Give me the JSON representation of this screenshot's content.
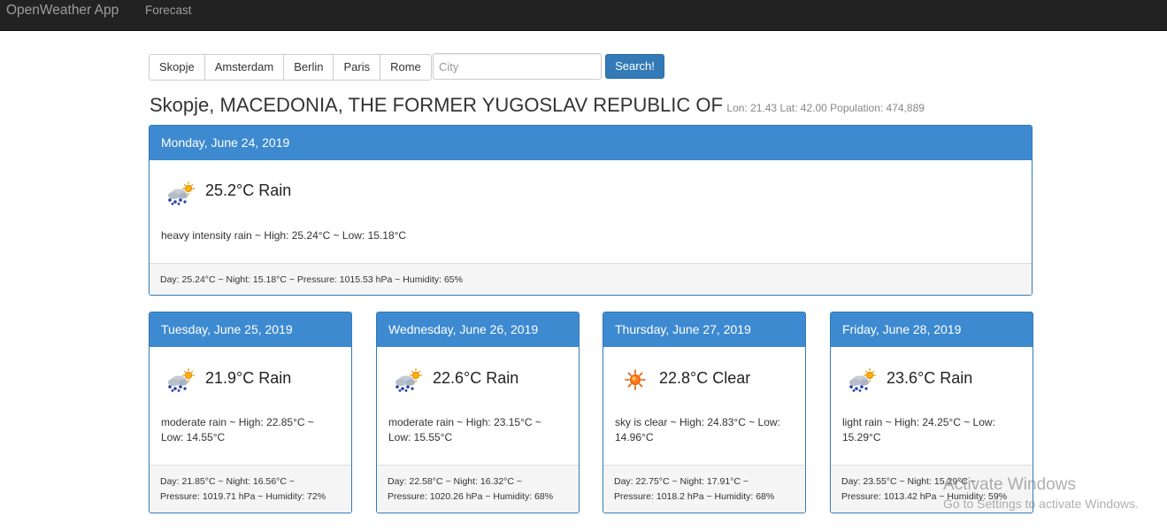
{
  "navbar": {
    "brand": "OpenWeather App",
    "forecast_link": "Forecast"
  },
  "cities": [
    "Skopje",
    "Amsterdam",
    "Berlin",
    "Paris",
    "Rome"
  ],
  "search": {
    "placeholder": "City",
    "button_label": "Search!"
  },
  "location": {
    "title": "Skopje, MACEDONIA, THE FORMER YUGOSLAV REPUBLIC OF",
    "meta": "Lon: 21.43 Lat: 42.00 Population: 474,889"
  },
  "today": {
    "date": "Monday, June 24, 2019",
    "icon": "rain-icon",
    "temp": "25.2°C Rain",
    "desc": "heavy intensity rain ~  High: 25.24°C ~  Low: 15.18°C",
    "footer": "Day: 25.24°C ~  Night: 15.18°C ~  Pressure: 1015.53 hPa ~  Humidity: 65%"
  },
  "forecast": [
    {
      "date": "Tuesday, June 25, 2019",
      "icon": "rain-icon",
      "temp": "21.9°C Rain",
      "desc": "moderate rain ~  High: 22.85°C ~ Low: 14.55°C",
      "footer_line1": "Day: 21.85°C ~  Night: 16.56°C ~",
      "footer_line2": "Pressure: 1019.71 hPa ~  Humidity: 72%"
    },
    {
      "date": "Wednesday, June 26, 2019",
      "icon": "rain-icon",
      "temp": "22.6°C Rain",
      "desc": "moderate rain ~  High: 23.15°C ~ Low: 15.55°C",
      "footer_line1": "Day: 22.58°C ~  Night: 16.32°C ~",
      "footer_line2": "Pressure: 1020.26 hPa ~  Humidity: 68%"
    },
    {
      "date": "Thursday, June 27, 2019",
      "icon": "sun-icon",
      "temp": "22.8°C Clear",
      "desc": "sky is clear ~  High: 24.83°C ~ Low: 14.96°C",
      "footer_line1": "Day: 22.75°C ~  Night: 17.91°C ~",
      "footer_line2": "Pressure: 1018.2 hPa ~  Humidity: 68%"
    },
    {
      "date": "Friday, June 28, 2019",
      "icon": "rain-icon",
      "temp": "23.6°C Rain",
      "desc": "light rain ~  High: 24.25°C ~  Low: 15.29°C",
      "footer_line1": "Day: 23.55°C ~  Night: 15.29°C ~",
      "footer_line2": "Pressure: 1013.42 hPa ~  Humidity: 59%"
    }
  ],
  "watermark": {
    "title": "Activate Windows",
    "subtitle": "Go to Settings to activate Windows."
  },
  "colors": {
    "navbar": "#222222",
    "panel_heading": "#3d8ad0",
    "primary": "#337ab7"
  }
}
